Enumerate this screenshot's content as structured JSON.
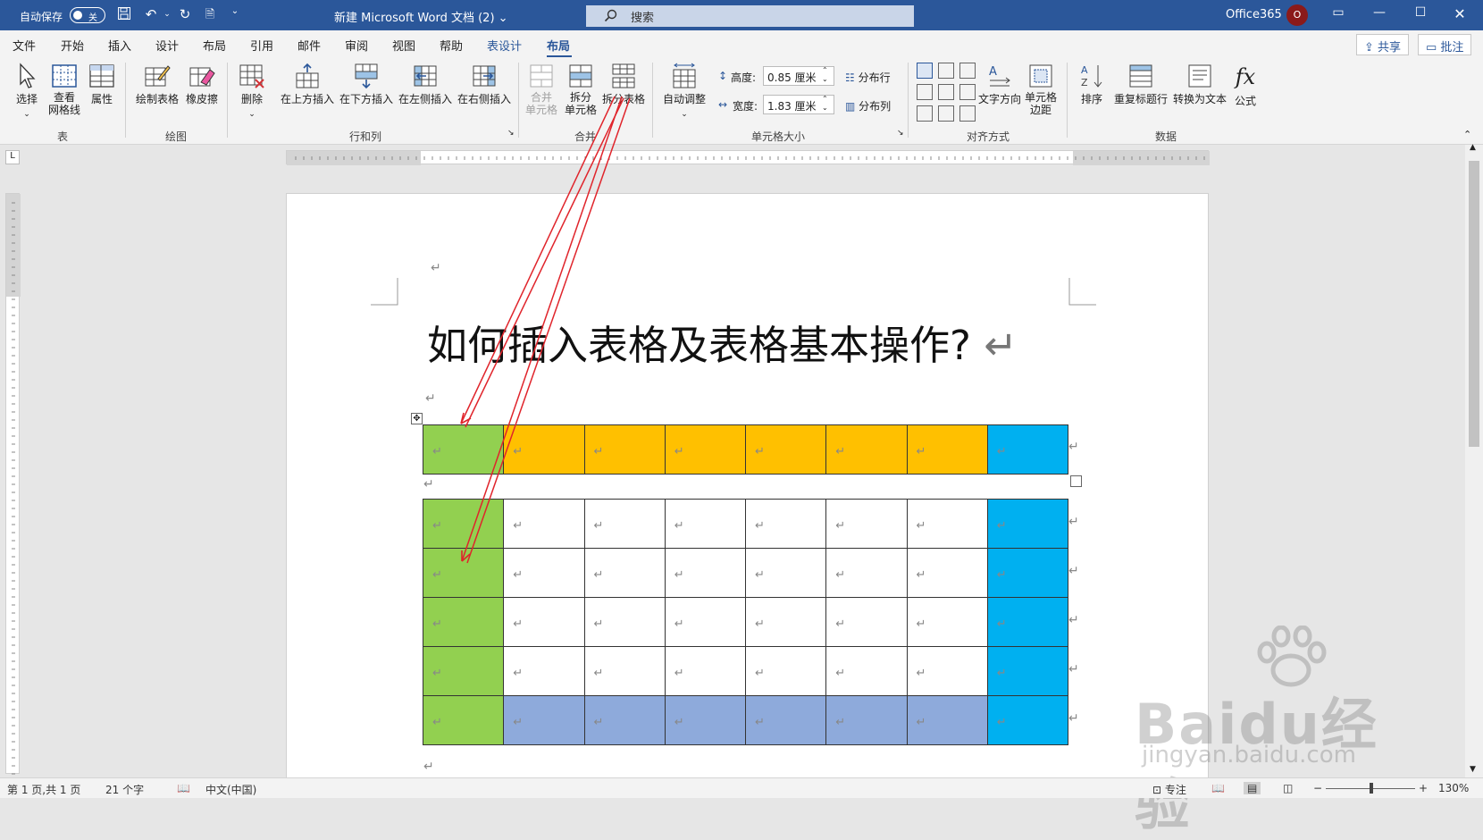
{
  "titlebar": {
    "autosave_label": "自动保存",
    "autosave_state": "关",
    "doc_title": "新建 Microsoft Word 文档 (2)",
    "search_placeholder": "搜索",
    "account": "Office365",
    "avatar_letter": "O"
  },
  "tabs": [
    "文件",
    "开始",
    "插入",
    "设计",
    "布局",
    "引用",
    "邮件",
    "审阅",
    "视图",
    "帮助",
    "表设计",
    "布局"
  ],
  "active_tab": "布局",
  "top_buttons": {
    "share": "共享",
    "comment": "批注"
  },
  "ribbon": {
    "groups": {
      "table": {
        "label": "表",
        "items": [
          "选择",
          "查看\n网格线",
          "属性"
        ]
      },
      "draw": {
        "label": "绘图",
        "items": [
          "绘制表格",
          "橡皮擦"
        ]
      },
      "rows_cols": {
        "label": "行和列",
        "items": [
          "删除",
          "在上方插入",
          "在下方插入",
          "在左侧插入",
          "在右侧插入"
        ]
      },
      "merge": {
        "label": "合并",
        "items": [
          "合并\n单元格",
          "拆分\n单元格",
          "拆分表格"
        ]
      },
      "cell_size": {
        "label": "单元格大小",
        "autofit": "自动调整",
        "height_label": "高度:",
        "height_value": "0.85 厘米",
        "width_label": "宽度:",
        "width_value": "1.83 厘米",
        "distribute_rows": "分布行",
        "distribute_cols": "分布列"
      },
      "align": {
        "label": "对齐方式",
        "items": [
          "文字方向",
          "单元格\n边距"
        ]
      },
      "data": {
        "label": "数据",
        "items": [
          "排序",
          "重复标题行",
          "转换为文本",
          "公式"
        ]
      }
    }
  },
  "document": {
    "heading": "如何插入表格及表格基本操作?",
    "paragraph_mark": "↵",
    "colors": {
      "green": "#92d050",
      "orange": "#ffc000",
      "blue": "#00b0f0",
      "lavender": "#8eaadb",
      "white": "#ffffff"
    },
    "table1": {
      "rows": [
        [
          "green",
          "orange",
          "orange",
          "orange",
          "orange",
          "orange",
          "orange",
          "blue"
        ]
      ]
    },
    "table2": {
      "rows": [
        [
          "green",
          "white",
          "white",
          "white",
          "white",
          "white",
          "white",
          "blue"
        ],
        [
          "green",
          "white",
          "white",
          "white",
          "white",
          "white",
          "white",
          "blue"
        ],
        [
          "green",
          "white",
          "white",
          "white",
          "white",
          "white",
          "white",
          "blue"
        ],
        [
          "green",
          "white",
          "white",
          "white",
          "white",
          "white",
          "white",
          "blue"
        ],
        [
          "green",
          "lavender",
          "lavender",
          "lavender",
          "lavender",
          "lavender",
          "lavender",
          "blue"
        ]
      ]
    }
  },
  "status": {
    "page": "第 1 页,共 1 页",
    "words": "21 个字",
    "lang": "中文(中国)",
    "focus": "专注",
    "zoom": "130%"
  },
  "watermark": {
    "brand": "Baidu经验",
    "url": "jingyan.baidu.com"
  }
}
